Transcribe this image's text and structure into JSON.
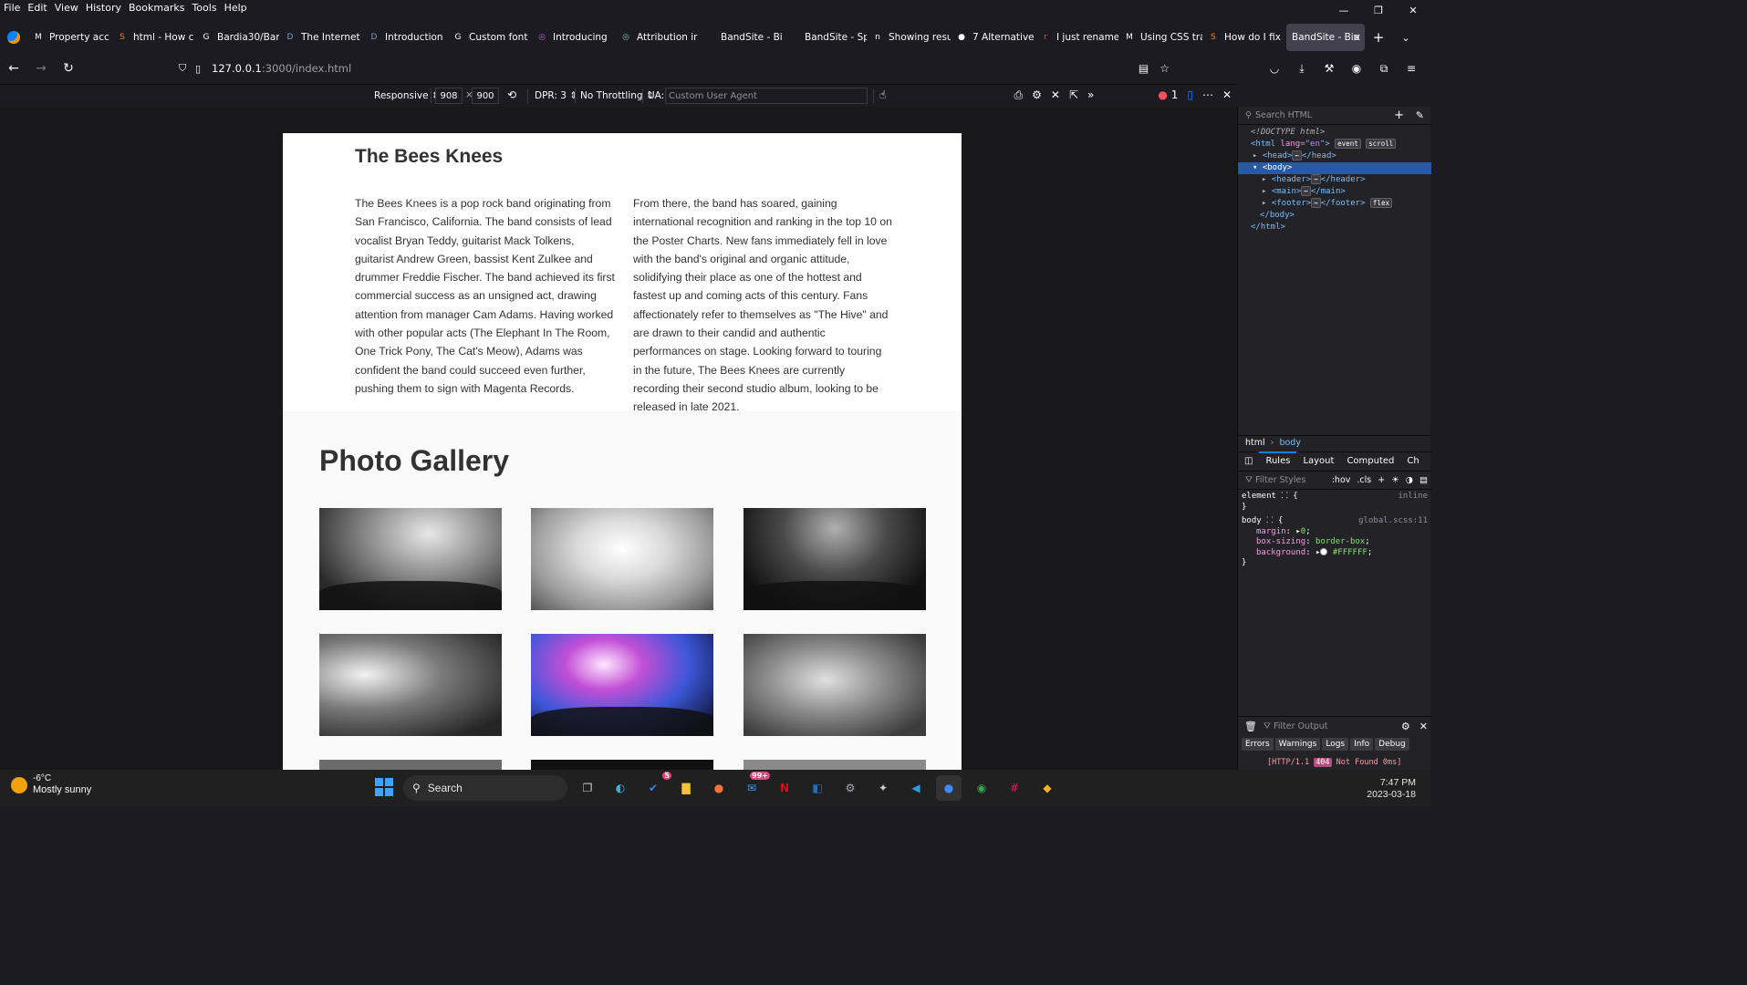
{
  "menu": [
    "File",
    "Edit",
    "View",
    "History",
    "Bookmarks",
    "Tools",
    "Help"
  ],
  "tabs": [
    {
      "icon": "M",
      "label": "Property acc"
    },
    {
      "icon": "S",
      "label": "html - How c"
    },
    {
      "icon": "G",
      "label": "Bardia30/Ban"
    },
    {
      "icon": "D",
      "label": "The Internet"
    },
    {
      "icon": "D",
      "label": "Introduction"
    },
    {
      "icon": "G",
      "label": "Custom font"
    },
    {
      "icon": "◎",
      "label": "Introducing"
    },
    {
      "icon": "◎",
      "label": "Attribution ir"
    },
    {
      "icon": "",
      "label": "BandSite - Biogra"
    },
    {
      "icon": "",
      "label": "BandSite - Sp"
    },
    {
      "icon": "n",
      "label": "Showing resu"
    },
    {
      "icon": "●",
      "label": "7 Alternative"
    },
    {
      "icon": "r",
      "label": "I just rename"
    },
    {
      "icon": "M",
      "label": "Using CSS tra"
    },
    {
      "icon": "S",
      "label": "How do I fix"
    },
    {
      "icon": "",
      "label": "BandSite - Bio"
    }
  ],
  "url": {
    "host": "127.0.0.1",
    "path": ":3000/index.html"
  },
  "rdm": {
    "device": "Responsive",
    "width": "908",
    "height": "900",
    "dpr": "DPR: 3",
    "throttling": "No Throttling",
    "ua_label": "UA:",
    "ua_placeholder": "Custom User Agent",
    "error_count": "1"
  },
  "page": {
    "bio_title": "The Bees Knees",
    "bio_col1": "The Bees Knees is a pop rock band originating from San Francisco, California. The band consists of lead vocalist Bryan Teddy, guitarist Mack Tolkens, guitarist Andrew Green, bassist Kent Zulkee and drummer Freddie Fischer. The band achieved its first commercial success as an unsigned act, drawing attention from manager Cam Adams. Having worked with other popular acts (The Elephant In The Room, One Trick Pony, The Cat's Meow), Adams was confident the band could succeed even further, pushing them to sign with Magenta Records.",
    "bio_col2": "From there, the band has soared, gaining international recognition and ranking in the top 10 on the Poster Charts. New fans immediately fell in love with the band's original and organic attitude, solidifying their place as one of the hottest and fastest up and coming acts of this century. Fans affectionately refer to themselves as \"The Hive\" and are drawn to their candid and authentic performances on stage. Looking forward to touring in the future, The Bees Knees are currently recording their second studio album, looking to be released in late 2021.",
    "gallery_title": "Photo Gallery"
  },
  "devtools": {
    "search_placeholder": "Search HTML",
    "breadcrumb": [
      "html",
      "body"
    ],
    "side_tabs": [
      "Rules",
      "Layout",
      "Computed",
      "Ch"
    ],
    "rules_filter": "Filter Styles",
    "hov": ":hov",
    "cls": ".cls",
    "element_selector": "element",
    "element_source": "inline",
    "body_selector": "body",
    "body_source": "global.scss:11",
    "props": [
      {
        "name": "margin",
        "value": "0"
      },
      {
        "name": "box-sizing",
        "value": "border-box"
      },
      {
        "name": "background",
        "value": "#FFFFFF"
      }
    ],
    "console_filter": "Filter Output",
    "console_tabs": [
      "Errors",
      "Warnings",
      "Logs",
      "Info",
      "Debug"
    ],
    "console_msg_prefix": "[HTTP/1.1",
    "console_code": "404",
    "console_msg_suffix": "Not Found 0ms]"
  },
  "taskbar": {
    "temp": "-6°C",
    "weather": "Mostly sunny",
    "search": "Search",
    "mail_badge": "99+",
    "todo_badge": "5",
    "time": "7:47 PM",
    "date": "2023-03-18"
  }
}
